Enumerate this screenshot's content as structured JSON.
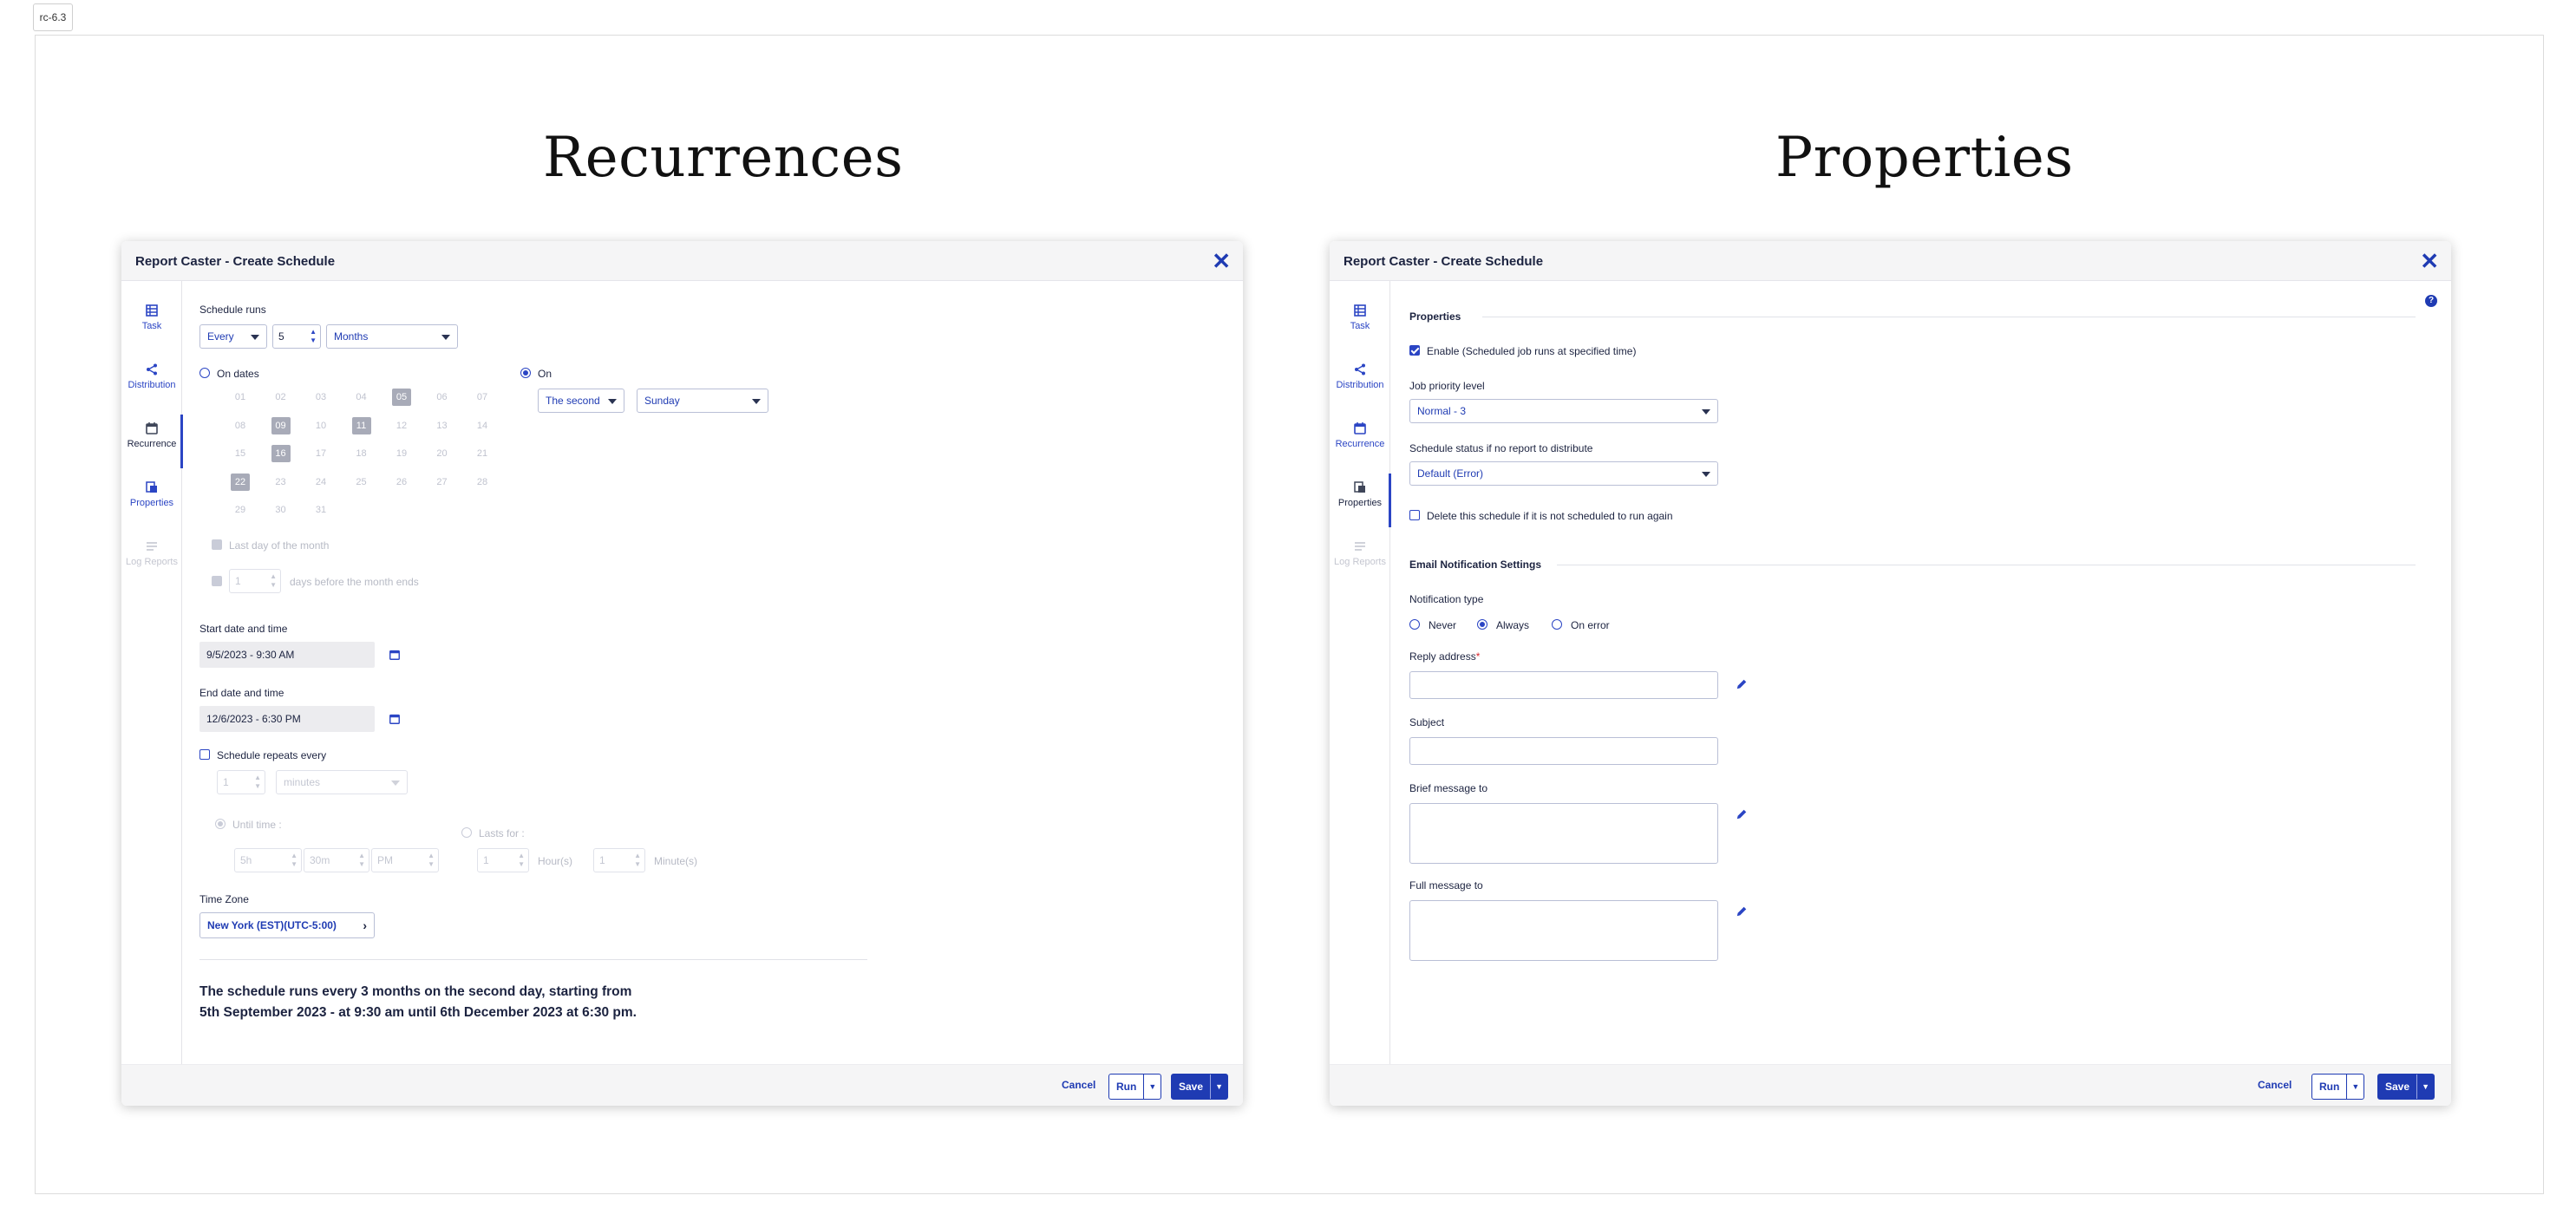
{
  "version_tag": "rc-6.3",
  "titles": {
    "left": "Recurrences",
    "right": "Properties"
  },
  "dialog": {
    "title": "Report Caster - Create Schedule",
    "nav": [
      {
        "label": "Task",
        "icon": "table-icon"
      },
      {
        "label": "Distribution",
        "icon": "share-icon"
      },
      {
        "label": "Recurrence",
        "icon": "calendar-icon"
      },
      {
        "label": "Properties",
        "icon": "properties-icon"
      },
      {
        "label": "Log Reports",
        "icon": "log-reports-icon"
      }
    ],
    "footer": {
      "cancel": "Cancel",
      "run": "Run",
      "save": "Save"
    }
  },
  "recurrence": {
    "schedule_runs_label": "Schedule runs",
    "every": "Every",
    "interval": "5",
    "unit": "Months",
    "on_dates_label": "On dates",
    "on_label": "On",
    "on_selected": true,
    "ordinal": "The second",
    "weekday": "Sunday",
    "days": [
      "01",
      "02",
      "03",
      "04",
      "05",
      "06",
      "07",
      "08",
      "09",
      "10",
      "11",
      "12",
      "13",
      "14",
      "15",
      "16",
      "17",
      "18",
      "19",
      "20",
      "21",
      "22",
      "23",
      "24",
      "25",
      "26",
      "27",
      "28",
      "29",
      "30",
      "31"
    ],
    "selected_days": [
      "05",
      "09",
      "11",
      "16",
      "22"
    ],
    "last_day_label": "Last day of the month",
    "days_before_value": "1",
    "days_before_label": "days before the month ends",
    "start_label": "Start date and time",
    "start_value": "9/5/2023 - 9:30 AM",
    "end_label": "End date and time",
    "end_value": "12/6/2023 - 6:30 PM",
    "repeats_label": "Schedule repeats every",
    "repeats_value": "1",
    "repeats_unit": "minutes",
    "until_label": "Until time :",
    "until_hour": "5h",
    "until_min": "30m",
    "until_ampm": "PM",
    "lasts_label": "Lasts for :",
    "lasts_hours": "1",
    "hours_label": "Hour(s)",
    "lasts_minutes": "1",
    "minutes_label": "Minute(s)",
    "timezone_label": "Time Zone",
    "timezone_value": "New York (EST)(UTC-5:00)",
    "summary_line1": "The schedule runs every 3 months on the second day, starting from",
    "summary_line2": "5th September 2023 - at 9:30 am until 6th December 2023 at 6:30 pm."
  },
  "properties": {
    "section_title": "Properties",
    "enable_label": "Enable (Scheduled job runs at specified time)",
    "priority_label": "Job priority level",
    "priority_value": "Normal - 3",
    "status_label": "Schedule status if no report to distribute",
    "status_value": "Default (Error)",
    "delete_label": "Delete this schedule if it is not scheduled to run again",
    "email_section": "Email Notification Settings",
    "notification_label": "Notification type",
    "options": [
      "Never",
      "Always",
      "On error"
    ],
    "selected_option": "Always",
    "reply_label": "Reply address",
    "required_mark": "*",
    "subject_label": "Subject",
    "brief_label": "Brief message to",
    "full_label": "Full message to",
    "help": "?"
  }
}
